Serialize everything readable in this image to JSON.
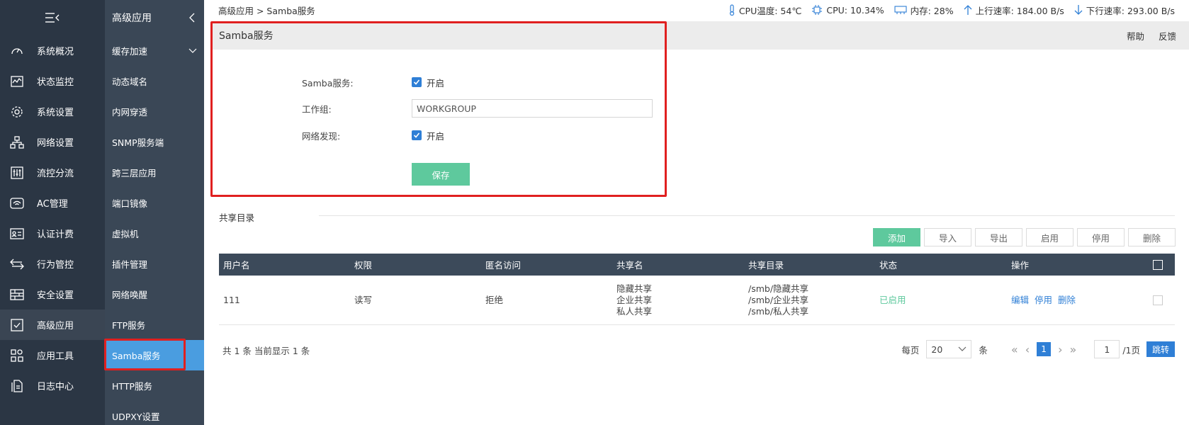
{
  "nav1": {
    "items": [
      {
        "label": "系统概况",
        "icon": "dashboard-icon"
      },
      {
        "label": "状态监控",
        "icon": "monitor-icon"
      },
      {
        "label": "系统设置",
        "icon": "gear-icon"
      },
      {
        "label": "网络设置",
        "icon": "network-icon"
      },
      {
        "label": "流控分流",
        "icon": "sliders-icon"
      },
      {
        "label": "AC管理",
        "icon": "wifi-icon"
      },
      {
        "label": "认证计费",
        "icon": "id-card-icon"
      },
      {
        "label": "行为管控",
        "icon": "arrows-icon"
      },
      {
        "label": "安全设置",
        "icon": "firewall-icon"
      },
      {
        "label": "高级应用",
        "icon": "check-screen-icon"
      },
      {
        "label": "应用工具",
        "icon": "apps-icon"
      },
      {
        "label": "日志中心",
        "icon": "document-icon"
      }
    ]
  },
  "nav2": {
    "title": "高级应用",
    "items": [
      {
        "label": "缓存加速"
      },
      {
        "label": "动态域名"
      },
      {
        "label": "内网穿透"
      },
      {
        "label": "SNMP服务端"
      },
      {
        "label": "跨三层应用"
      },
      {
        "label": "端口镜像"
      },
      {
        "label": "虚拟机"
      },
      {
        "label": "插件管理"
      },
      {
        "label": "网络唤醒"
      },
      {
        "label": "FTP服务"
      },
      {
        "label": "Samba服务"
      },
      {
        "label": "HTTP服务"
      },
      {
        "label": "UDPXY设置"
      }
    ]
  },
  "header": {
    "breadcrumb": "高级应用 > Samba服务",
    "cpu_temp": "CPU温度: 54℃",
    "cpu": "CPU: 10.34%",
    "mem": "内存: 28%",
    "up": "上行速率: 184.00 B/s",
    "down": "下行速率: 293.00 B/s"
  },
  "panel": {
    "title": "Samba服务",
    "help": "帮助",
    "feedback": "反馈"
  },
  "form": {
    "samba_label": "Samba服务:",
    "samba_value": "开启",
    "workgroup_label": "工作组:",
    "workgroup_value": "WORKGROUP",
    "discovery_label": "网络发现:",
    "discovery_value": "开启",
    "save": "保存"
  },
  "share": {
    "title": "共享目录",
    "buttons": {
      "add": "添加",
      "import": "导入",
      "export": "导出",
      "enable": "启用",
      "disable": "停用",
      "delete": "删除"
    },
    "columns": {
      "user": "用户名",
      "perm": "权限",
      "anon": "匿名访问",
      "name": "共享名",
      "dir": "共享目录",
      "status": "状态",
      "ops": "操作"
    },
    "rows": [
      {
        "user": "111",
        "perm": "读写",
        "anon": "拒绝",
        "names": [
          "隐藏共享",
          "企业共享",
          "私人共享"
        ],
        "dirs": [
          "/smb/隐藏共享",
          "/smb/企业共享",
          "/smb/私人共享"
        ],
        "status": "已启用",
        "ops": {
          "edit": "编辑",
          "stop": "停用",
          "del": "删除"
        }
      }
    ],
    "summary": "共 1 条 当前显示 1 条",
    "per_page_label": "每页",
    "per_page": "20",
    "per_page_unit": "条",
    "current_page": "1",
    "page_input": "1",
    "page_total": "/1页",
    "jump": "跳转"
  },
  "colors": {
    "accent": "#2f7fd6",
    "green": "#5ec99d",
    "nav_dark": "#2b3644",
    "nav_mid": "#3a4756",
    "nav_active": "#4a9de0",
    "highlight": "#e02020"
  }
}
